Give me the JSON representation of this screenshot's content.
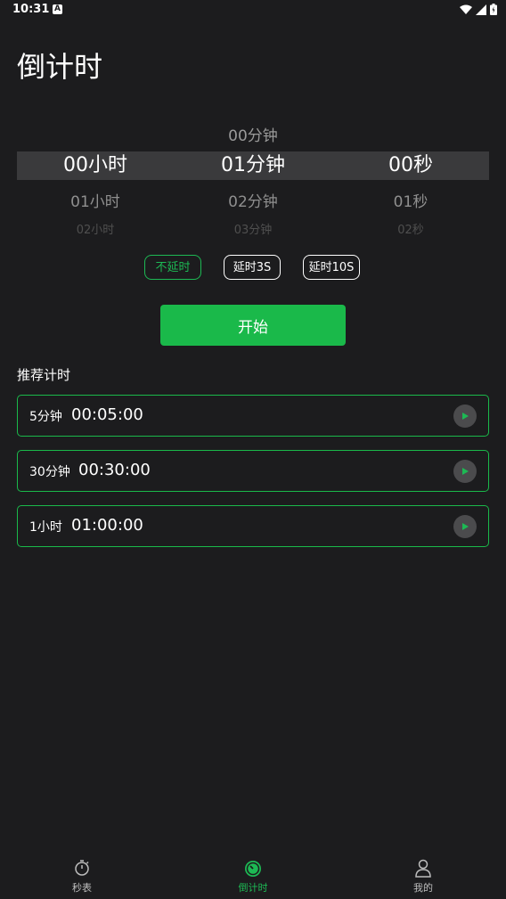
{
  "status": {
    "time": "10:31"
  },
  "page": {
    "title": "倒计时"
  },
  "picker": {
    "hours": {
      "selected": "00小时",
      "below1": "01小时",
      "below2": "02小时"
    },
    "minutes": {
      "above": "00分钟",
      "selected": "01分钟",
      "below1": "02分钟",
      "below2": "03分钟"
    },
    "seconds": {
      "selected": "00秒",
      "below1": "01秒",
      "below2": "02秒"
    }
  },
  "delays": {
    "options": [
      "不延时",
      "延时3S",
      "延时10S"
    ],
    "selected": "不延时"
  },
  "start_label": "开始",
  "recommended": {
    "title": "推荐计时",
    "items": [
      {
        "label": "5分钟",
        "time": "00:05:00"
      },
      {
        "label": "30分钟",
        "time": "00:30:00"
      },
      {
        "label": "1小时",
        "time": "01:00:00"
      }
    ]
  },
  "nav": {
    "items": [
      {
        "label": "秒表",
        "icon": "stopwatch-icon"
      },
      {
        "label": "倒计时",
        "icon": "timer-icon"
      },
      {
        "label": "我的",
        "icon": "person-icon"
      }
    ],
    "active": "倒计时"
  },
  "colors": {
    "background": "#1c1c1e",
    "accent": "#1ab94a",
    "band": "#3a3a3c"
  }
}
